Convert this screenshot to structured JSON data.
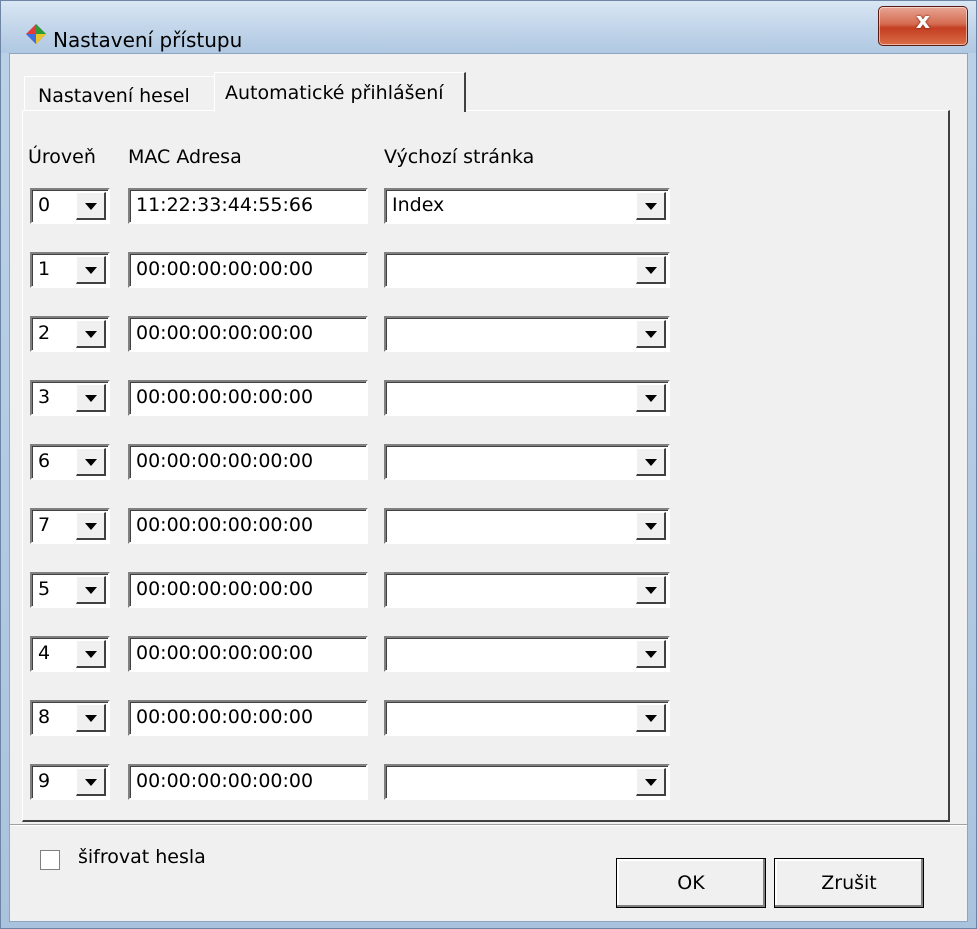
{
  "window": {
    "title": "Nastavení přístupu",
    "close_label": "x"
  },
  "tabs": [
    {
      "label": "Nastavení hesel",
      "active": false
    },
    {
      "label": "Automatické přihlášení",
      "active": true
    }
  ],
  "columns": {
    "level": "Úroveň",
    "mac": "MAC Adresa",
    "page": "Výchozí stránka"
  },
  "rows": [
    {
      "level": "0",
      "mac": "11:22:33:44:55:66",
      "page": "Index"
    },
    {
      "level": "1",
      "mac": "00:00:00:00:00:00",
      "page": ""
    },
    {
      "level": "2",
      "mac": "00:00:00:00:00:00",
      "page": ""
    },
    {
      "level": "3",
      "mac": "00:00:00:00:00:00",
      "page": ""
    },
    {
      "level": "6",
      "mac": "00:00:00:00:00:00",
      "page": ""
    },
    {
      "level": "7",
      "mac": "00:00:00:00:00:00",
      "page": ""
    },
    {
      "level": "5",
      "mac": "00:00:00:00:00:00",
      "page": ""
    },
    {
      "level": "4",
      "mac": "00:00:00:00:00:00",
      "page": ""
    },
    {
      "level": "8",
      "mac": "00:00:00:00:00:00",
      "page": ""
    },
    {
      "level": "9",
      "mac": "00:00:00:00:00:00",
      "page": ""
    }
  ],
  "encrypt": {
    "label": "šifrovat hesla",
    "checked": false
  },
  "buttons": {
    "ok": "OK",
    "cancel": "Zrušit"
  }
}
